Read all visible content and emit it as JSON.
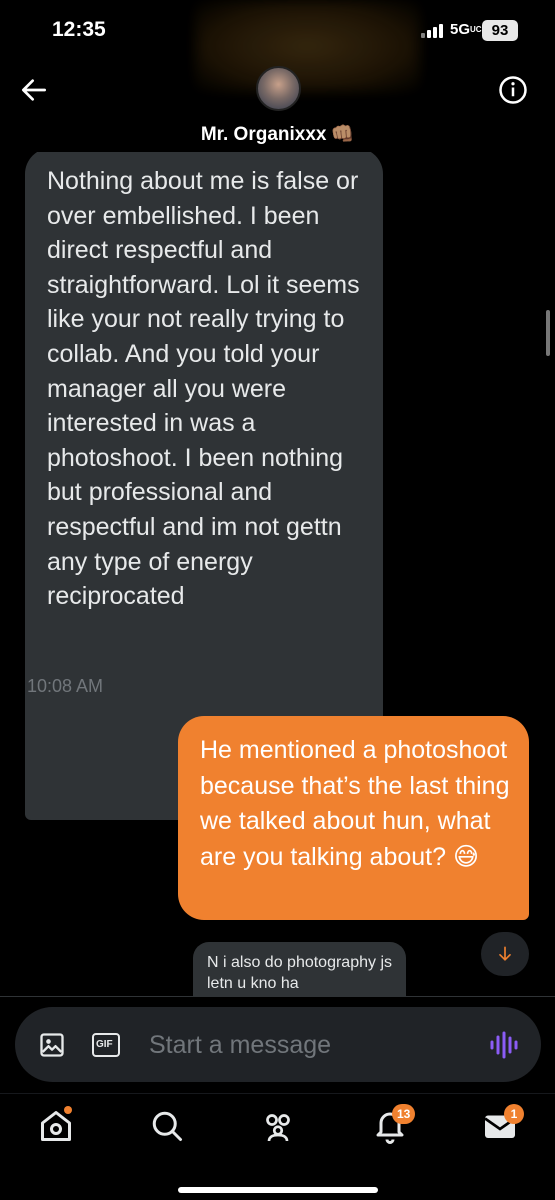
{
  "status_bar": {
    "time": "12:35",
    "network": "5G",
    "network_suffix": "UC",
    "battery": "93"
  },
  "header": {
    "contact_name": "Mr. Organixxx",
    "name_emoji": "👊🏽"
  },
  "messages": [
    {
      "direction": "incoming",
      "text": "Nothing about me is false or over embellished. I been direct respectful and straightforward. Lol it seems like your not really trying to collab. And you told your manager all you were interested in was a photoshoot. I been nothing but professional and respectful and im not gettn any type of energy reciprocated",
      "timestamp": "10:08 AM"
    },
    {
      "direction": "outgoing",
      "text": "He mentioned a photoshoot because that’s the last thing we talked about hun, what are you talking about? 😅"
    },
    {
      "direction": "incoming",
      "text": "N i also do photography js letn u kno ha"
    }
  ],
  "composer": {
    "placeholder": "Start a message",
    "gif_label": "GIF"
  },
  "tabbar": {
    "items": [
      {
        "name": "home",
        "icon": "home-icon"
      },
      {
        "name": "search",
        "icon": "search-icon"
      },
      {
        "name": "communities",
        "icon": "people-icon"
      },
      {
        "name": "notifications",
        "icon": "bell-icon",
        "badge": "13"
      },
      {
        "name": "messages",
        "icon": "mail-icon",
        "badge": "1"
      }
    ]
  },
  "colors": {
    "accent": "#f0812f",
    "incoming_bubble": "#2f3336",
    "voice": "#8b5cf6",
    "background": "#000000"
  }
}
